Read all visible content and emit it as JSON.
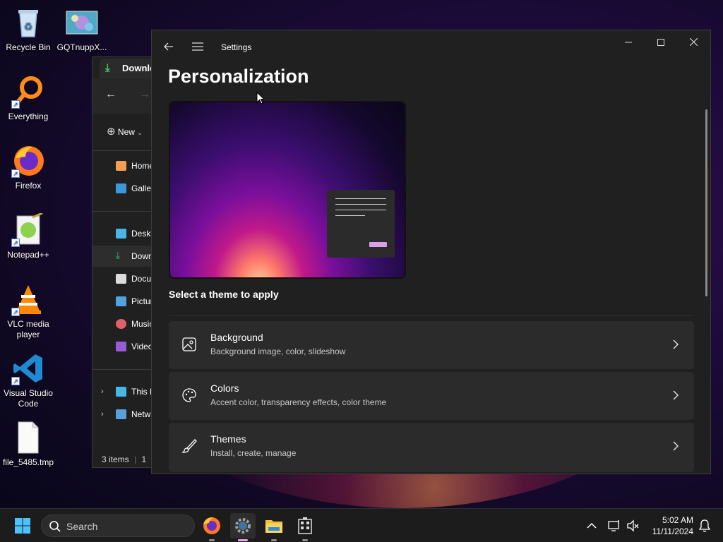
{
  "desktop": {
    "icons": [
      {
        "label": "Recycle Bin",
        "icon": "recycle-bin-icon"
      },
      {
        "label": "GQTnuppX...",
        "icon": "image-file-icon"
      },
      {
        "label": "Everything",
        "icon": "everything-search-icon"
      },
      {
        "label": "Firefox",
        "icon": "firefox-icon"
      },
      {
        "label": "Notepad++",
        "icon": "notepad-plus-plus-icon"
      },
      {
        "label": "VLC media player",
        "icon": "vlc-icon"
      },
      {
        "label": "Visual Studio Code",
        "icon": "vscode-icon"
      },
      {
        "label": "file_5485.tmp",
        "icon": "blank-file-icon"
      }
    ]
  },
  "explorer": {
    "tab_label": "Downlo",
    "new_label": "New",
    "nav_items": [
      "Home",
      "Galler",
      "Deskt",
      "Down",
      "Docu",
      "Pictur",
      "Music",
      "Video"
    ],
    "tree_items": [
      "This P",
      "Netw"
    ],
    "status_items": "3 items",
    "status_more": "1"
  },
  "settings": {
    "window_title": "Settings",
    "page_title": "Personalization",
    "section_label": "Select a theme to apply",
    "cards": [
      {
        "title": "Background",
        "subtitle": "Background image, color, slideshow",
        "icon": "image-icon"
      },
      {
        "title": "Colors",
        "subtitle": "Accent color, transparency effects, color theme",
        "icon": "palette-icon"
      },
      {
        "title": "Themes",
        "subtitle": "Install, create, manage",
        "icon": "brush-icon"
      }
    ]
  },
  "taskbar": {
    "search_label": "Search",
    "time": "5:02 AM",
    "date": "11/11/2024"
  },
  "colors": {
    "accent": "#e7a3e8",
    "window_bg": "#202020",
    "card_bg": "#2b2b2b"
  }
}
